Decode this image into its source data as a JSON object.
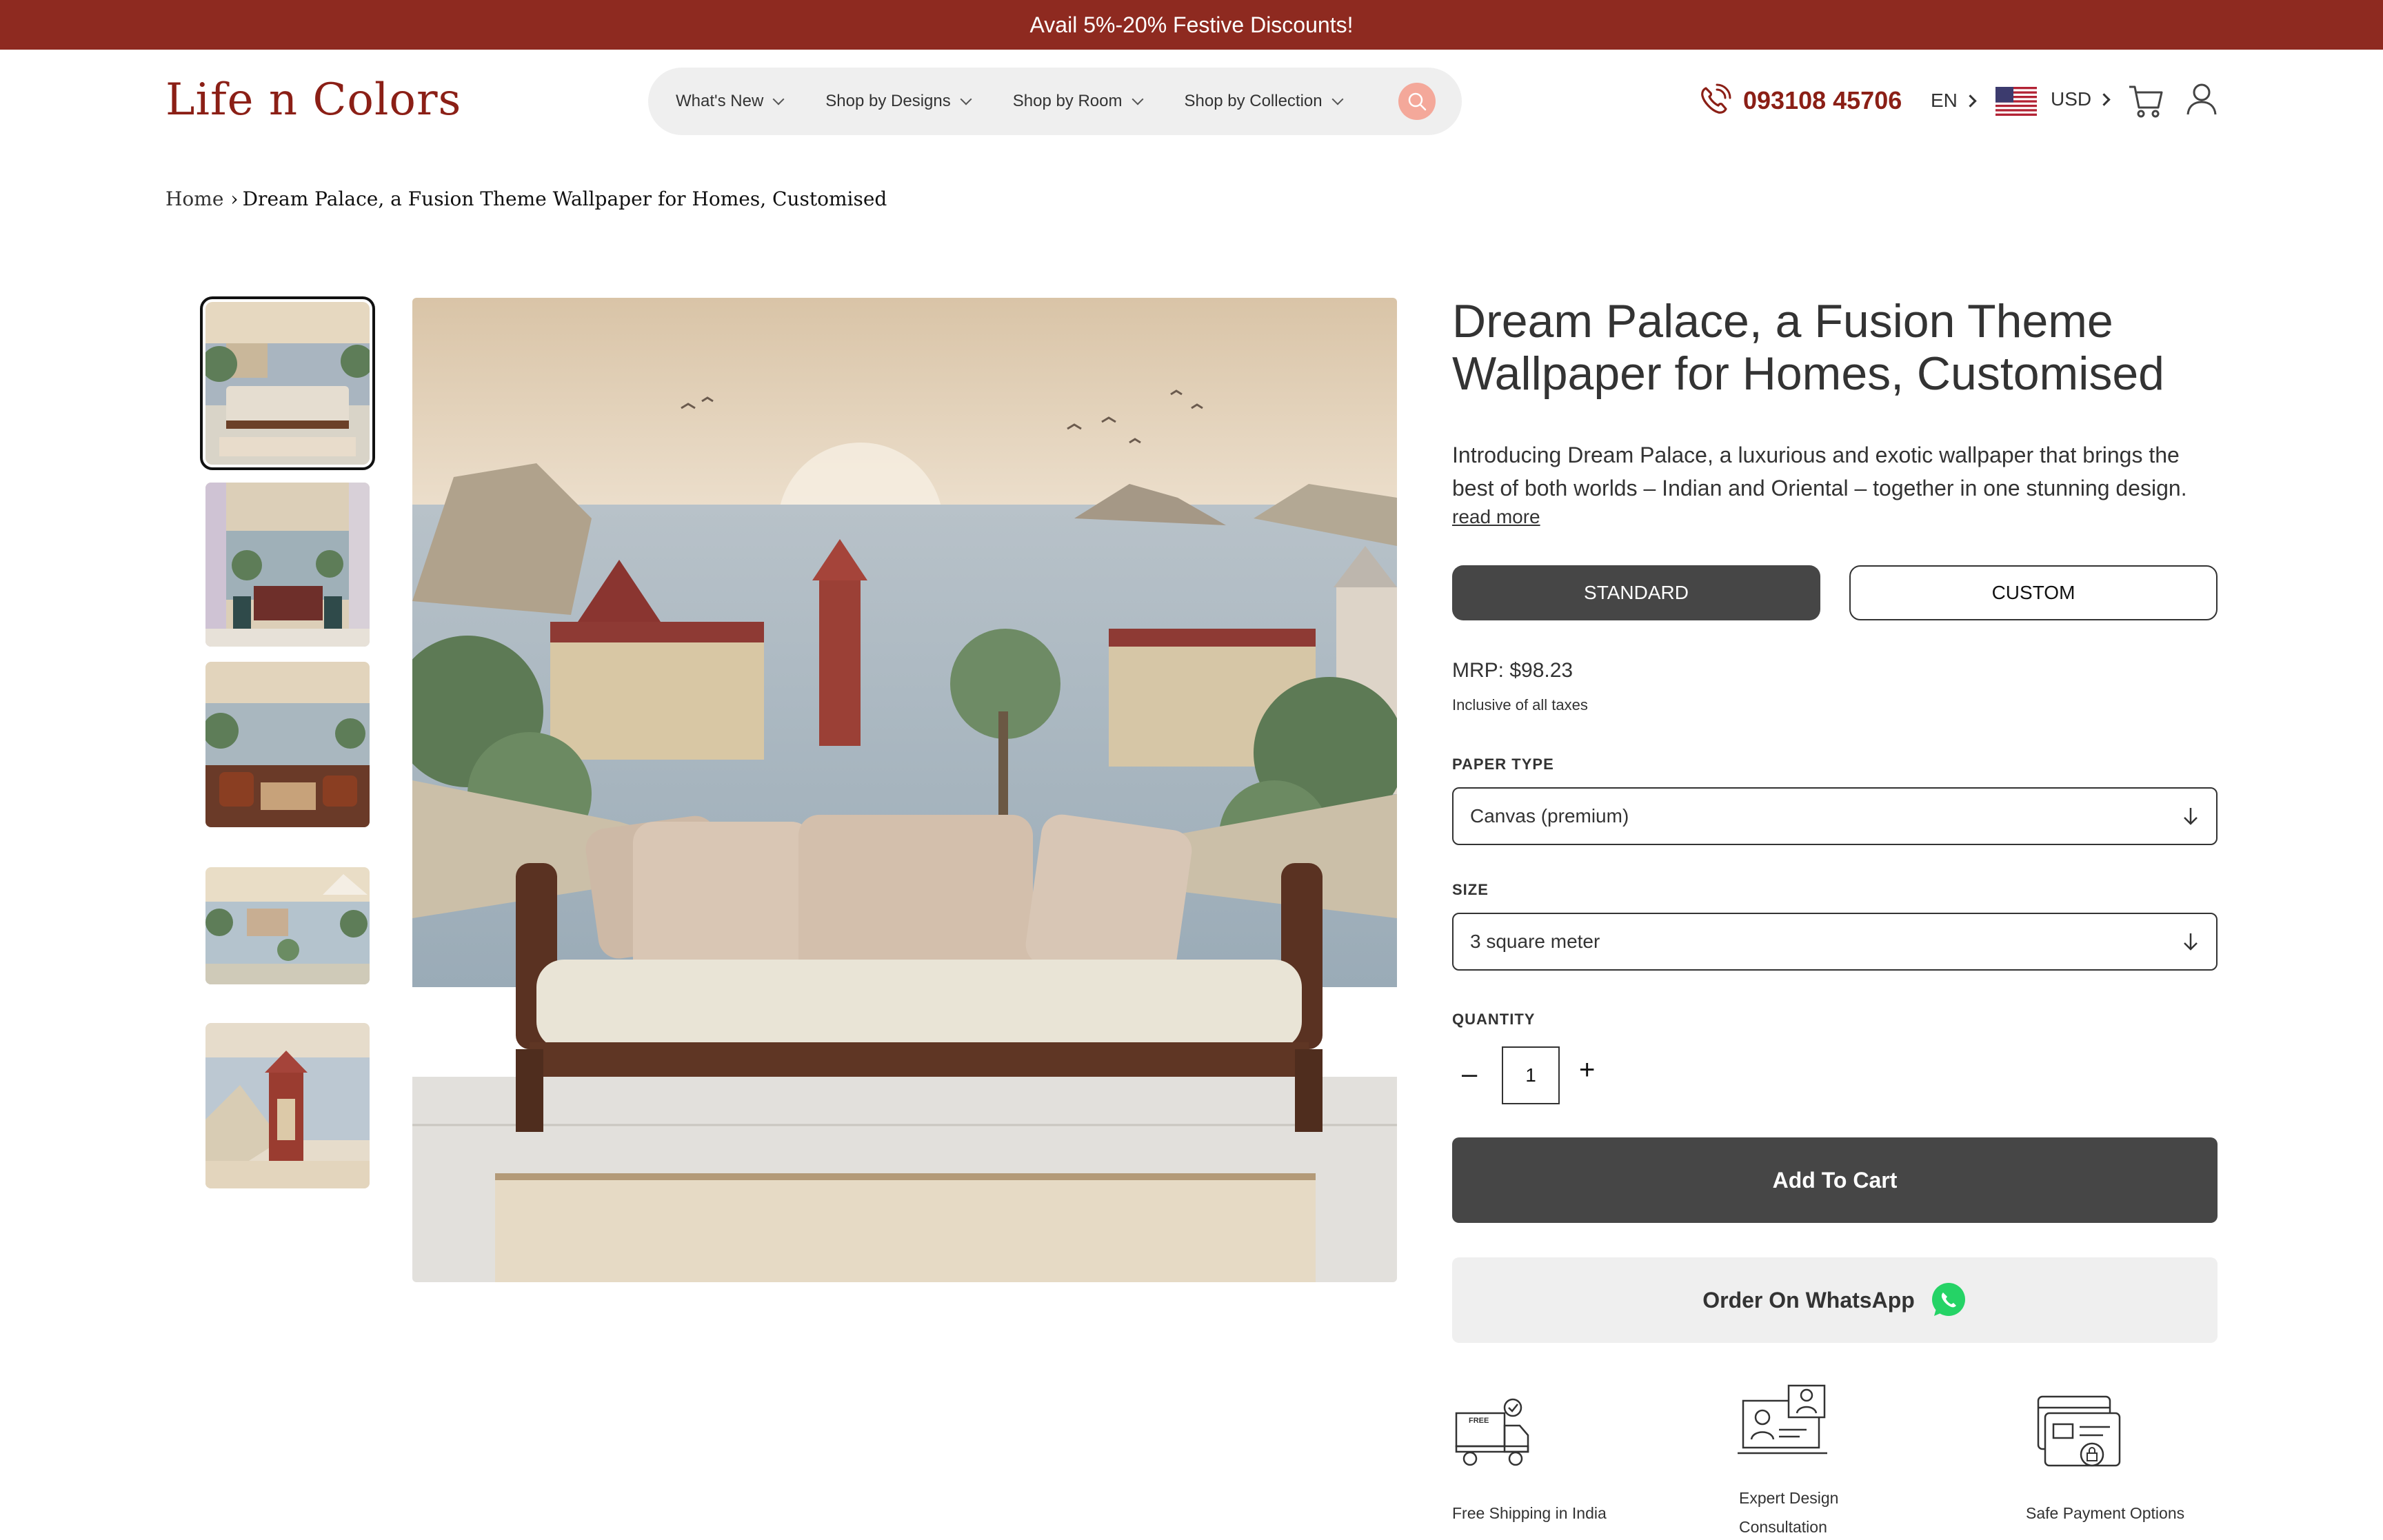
{
  "announcement": "Avail 5%-20% Festive Discounts!",
  "header": {
    "logo": "Life n Colors",
    "nav": [
      "What's New",
      "Shop by Designs",
      "Shop by Room",
      "Shop by Collection"
    ],
    "phone": "093108 45706",
    "language": "EN",
    "currency": "USD"
  },
  "breadcrumb": {
    "home": "Home",
    "separator": "›",
    "current": "Dream Palace, a Fusion Theme Wallpaper for Homes, Customised"
  },
  "product": {
    "title_line1": "Dream Palace, a Fusion Theme",
    "title_line2": "Wallpaper for Homes, Customised",
    "description_line1": "Introducing Dream Palace, a luxurious and exotic wallpaper that brings the",
    "description_line2": "best of both worlds – Indian and Oriental – together in one stunning design.",
    "read_more": "read more",
    "variant_standard": "STANDARD",
    "variant_custom": "CUSTOM",
    "mrp": "MRP: $98.23",
    "tax_note": "Inclusive of all taxes",
    "paper_type_label": "PAPER TYPE",
    "paper_type_value": "Canvas (premium)",
    "size_label": "SIZE",
    "size_value": "3 square meter",
    "quantity_label": "QUANTITY",
    "quantity_minus": "–",
    "quantity_value": "1",
    "quantity_plus": "+",
    "add_to_cart": "Add To Cart",
    "order_whatsapp": "Order On WhatsApp"
  },
  "features": {
    "shipping": "Free Shipping in India",
    "consult_line1": "Expert Design",
    "consult_line2": "Consultation",
    "payment": "Safe Payment Options",
    "free_tag": "FREE"
  },
  "colors": {
    "brand": "#8b1f16",
    "announcement_bg": "#8e2a20",
    "primary_button": "#464646",
    "search_button": "#f4a89a",
    "whatsapp": "#25d366"
  }
}
